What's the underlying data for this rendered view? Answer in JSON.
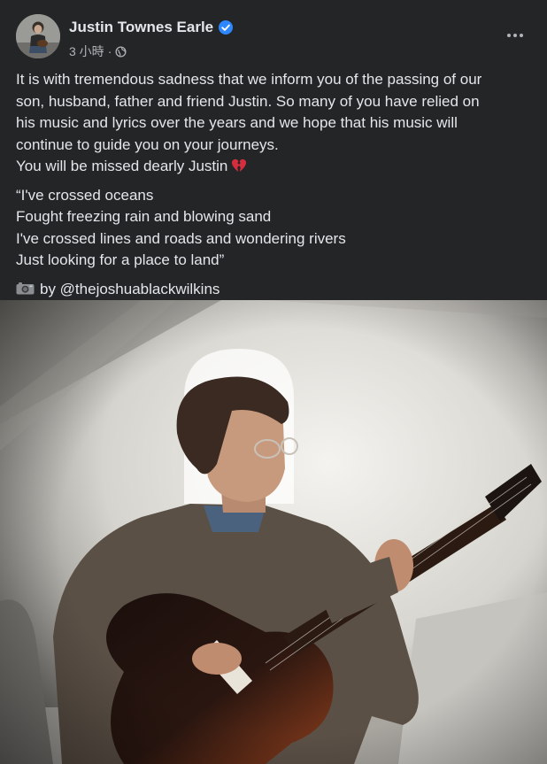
{
  "post": {
    "author": {
      "name": "Justin Townes Earle",
      "verified": true,
      "avatar_icon": "person-with-guitar-avatar"
    },
    "meta": {
      "time": "3 小時",
      "separator": "·",
      "audience_icon": "globe-icon"
    },
    "more_icon": "ellipsis-icon",
    "message": {
      "paragraph1": [
        "It is with tremendous sadness that we inform you of the passing of our",
        "son, husband, father and friend Justin. So many of you have relied on",
        "his music and lyrics over the years and we hope that his music will",
        "continue to guide you on your journeys."
      ],
      "missed_line": "You will be missed dearly Justin",
      "missed_emoji": "broken-heart-icon",
      "lyrics": [
        "“I've crossed oceans",
        "Fought freezing rain and blowing sand",
        "I've crossed lines and roads and wondering rivers",
        "Just looking for a place to land”"
      ],
      "credit_icon": "camera-icon",
      "credit": "by @thejoshuablackwilkins"
    },
    "photo": {
      "subject": "photo-man-playing-guitar"
    }
  },
  "colors": {
    "card_bg": "#242526",
    "primary_text": "#e4e6eb",
    "secondary_text": "#b0b3b8",
    "verified_blue": "#2d88ff"
  }
}
